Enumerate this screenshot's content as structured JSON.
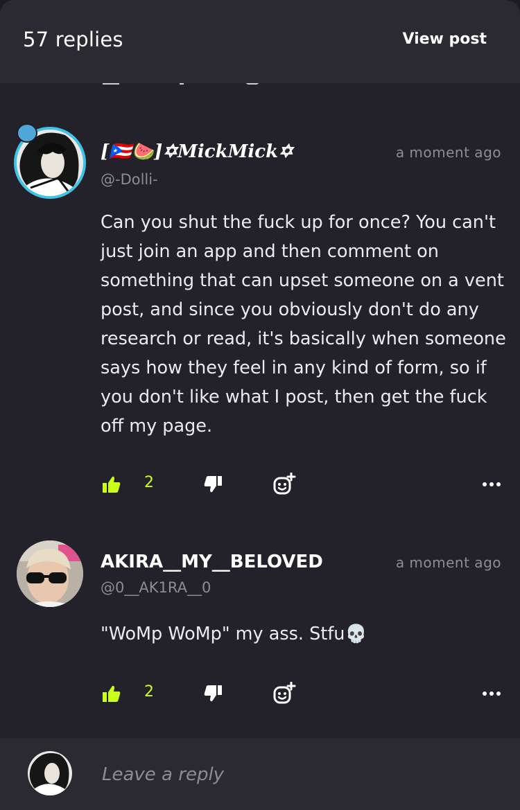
{
  "header": {
    "title": "57 replies",
    "view_post_label": "View post"
  },
  "comments": [
    {
      "display_name": "[🇵🇷🍉]✡MickMick✡",
      "handle": "@-Dolli-",
      "time": "a moment ago",
      "text": "Can you shut the fuck up for once? You can't just join an app and then comment on something that can upset someone on a vent post, and since you obviously don't do any research or read, it's basically when someone says how they feel in any kind of form, so if you don't like what I post, then get the fuck off my page.",
      "likes": "2"
    },
    {
      "display_name": "AKIRA__MY__BELOVED",
      "handle": "@0__AK1RA__0",
      "time": "a moment ago",
      "text": "\"WoMp WoMp\" my ass. Stfu💀",
      "likes": "2"
    }
  ],
  "reply": {
    "placeholder": "Leave a reply"
  },
  "colors": {
    "background": "#23222a",
    "header": "#2a2a30",
    "accent_like": "#c9ff1a",
    "muted_text": "#8d8c96",
    "avatar_ring": "#3fc4e8"
  },
  "icons": {
    "like": "thumbs-up-icon",
    "dislike": "thumbs-down-icon",
    "react": "add-reaction-icon",
    "more": "more-dots-icon"
  }
}
